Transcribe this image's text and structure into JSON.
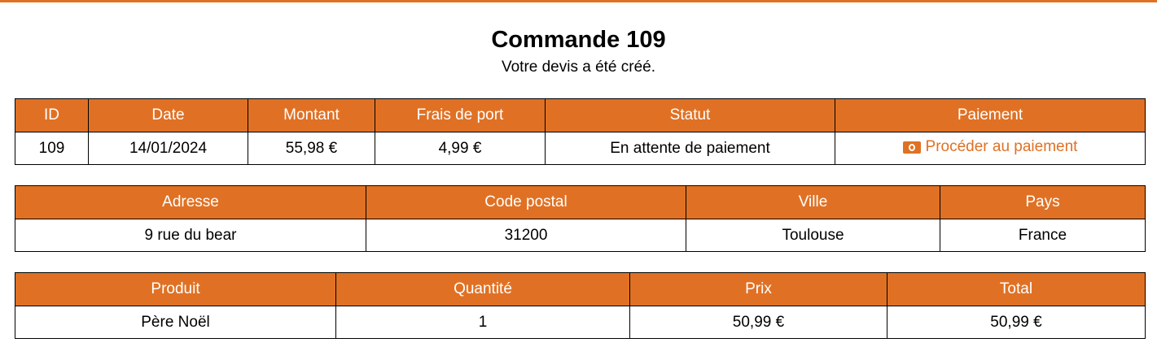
{
  "colors": {
    "accent": "#e07124"
  },
  "header": {
    "title": "Commande 109",
    "subtitle": "Votre devis a été créé."
  },
  "order": {
    "headers": {
      "id": "ID",
      "date": "Date",
      "amount": "Montant",
      "shipping": "Frais de port",
      "status": "Statut",
      "payment": "Paiement"
    },
    "row": {
      "id": "109",
      "date": "14/01/2024",
      "amount": "55,98 €",
      "shipping": "4,99 €",
      "status": "En attente de paiement",
      "payment_link": "Procéder au paiement",
      "payment_icon": "money-bill-icon"
    }
  },
  "address": {
    "headers": {
      "street": "Adresse",
      "postal_code": "Code postal",
      "city": "Ville",
      "country": "Pays"
    },
    "row": {
      "street": "9 rue du bear",
      "postal_code": "31200",
      "city": "Toulouse",
      "country": "France"
    }
  },
  "products": {
    "headers": {
      "product": "Produit",
      "quantity": "Quantité",
      "price": "Prix",
      "total": "Total"
    },
    "rows": [
      {
        "product": "Père Noël",
        "quantity": "1",
        "price": "50,99 €",
        "total": "50,99 €"
      }
    ]
  }
}
